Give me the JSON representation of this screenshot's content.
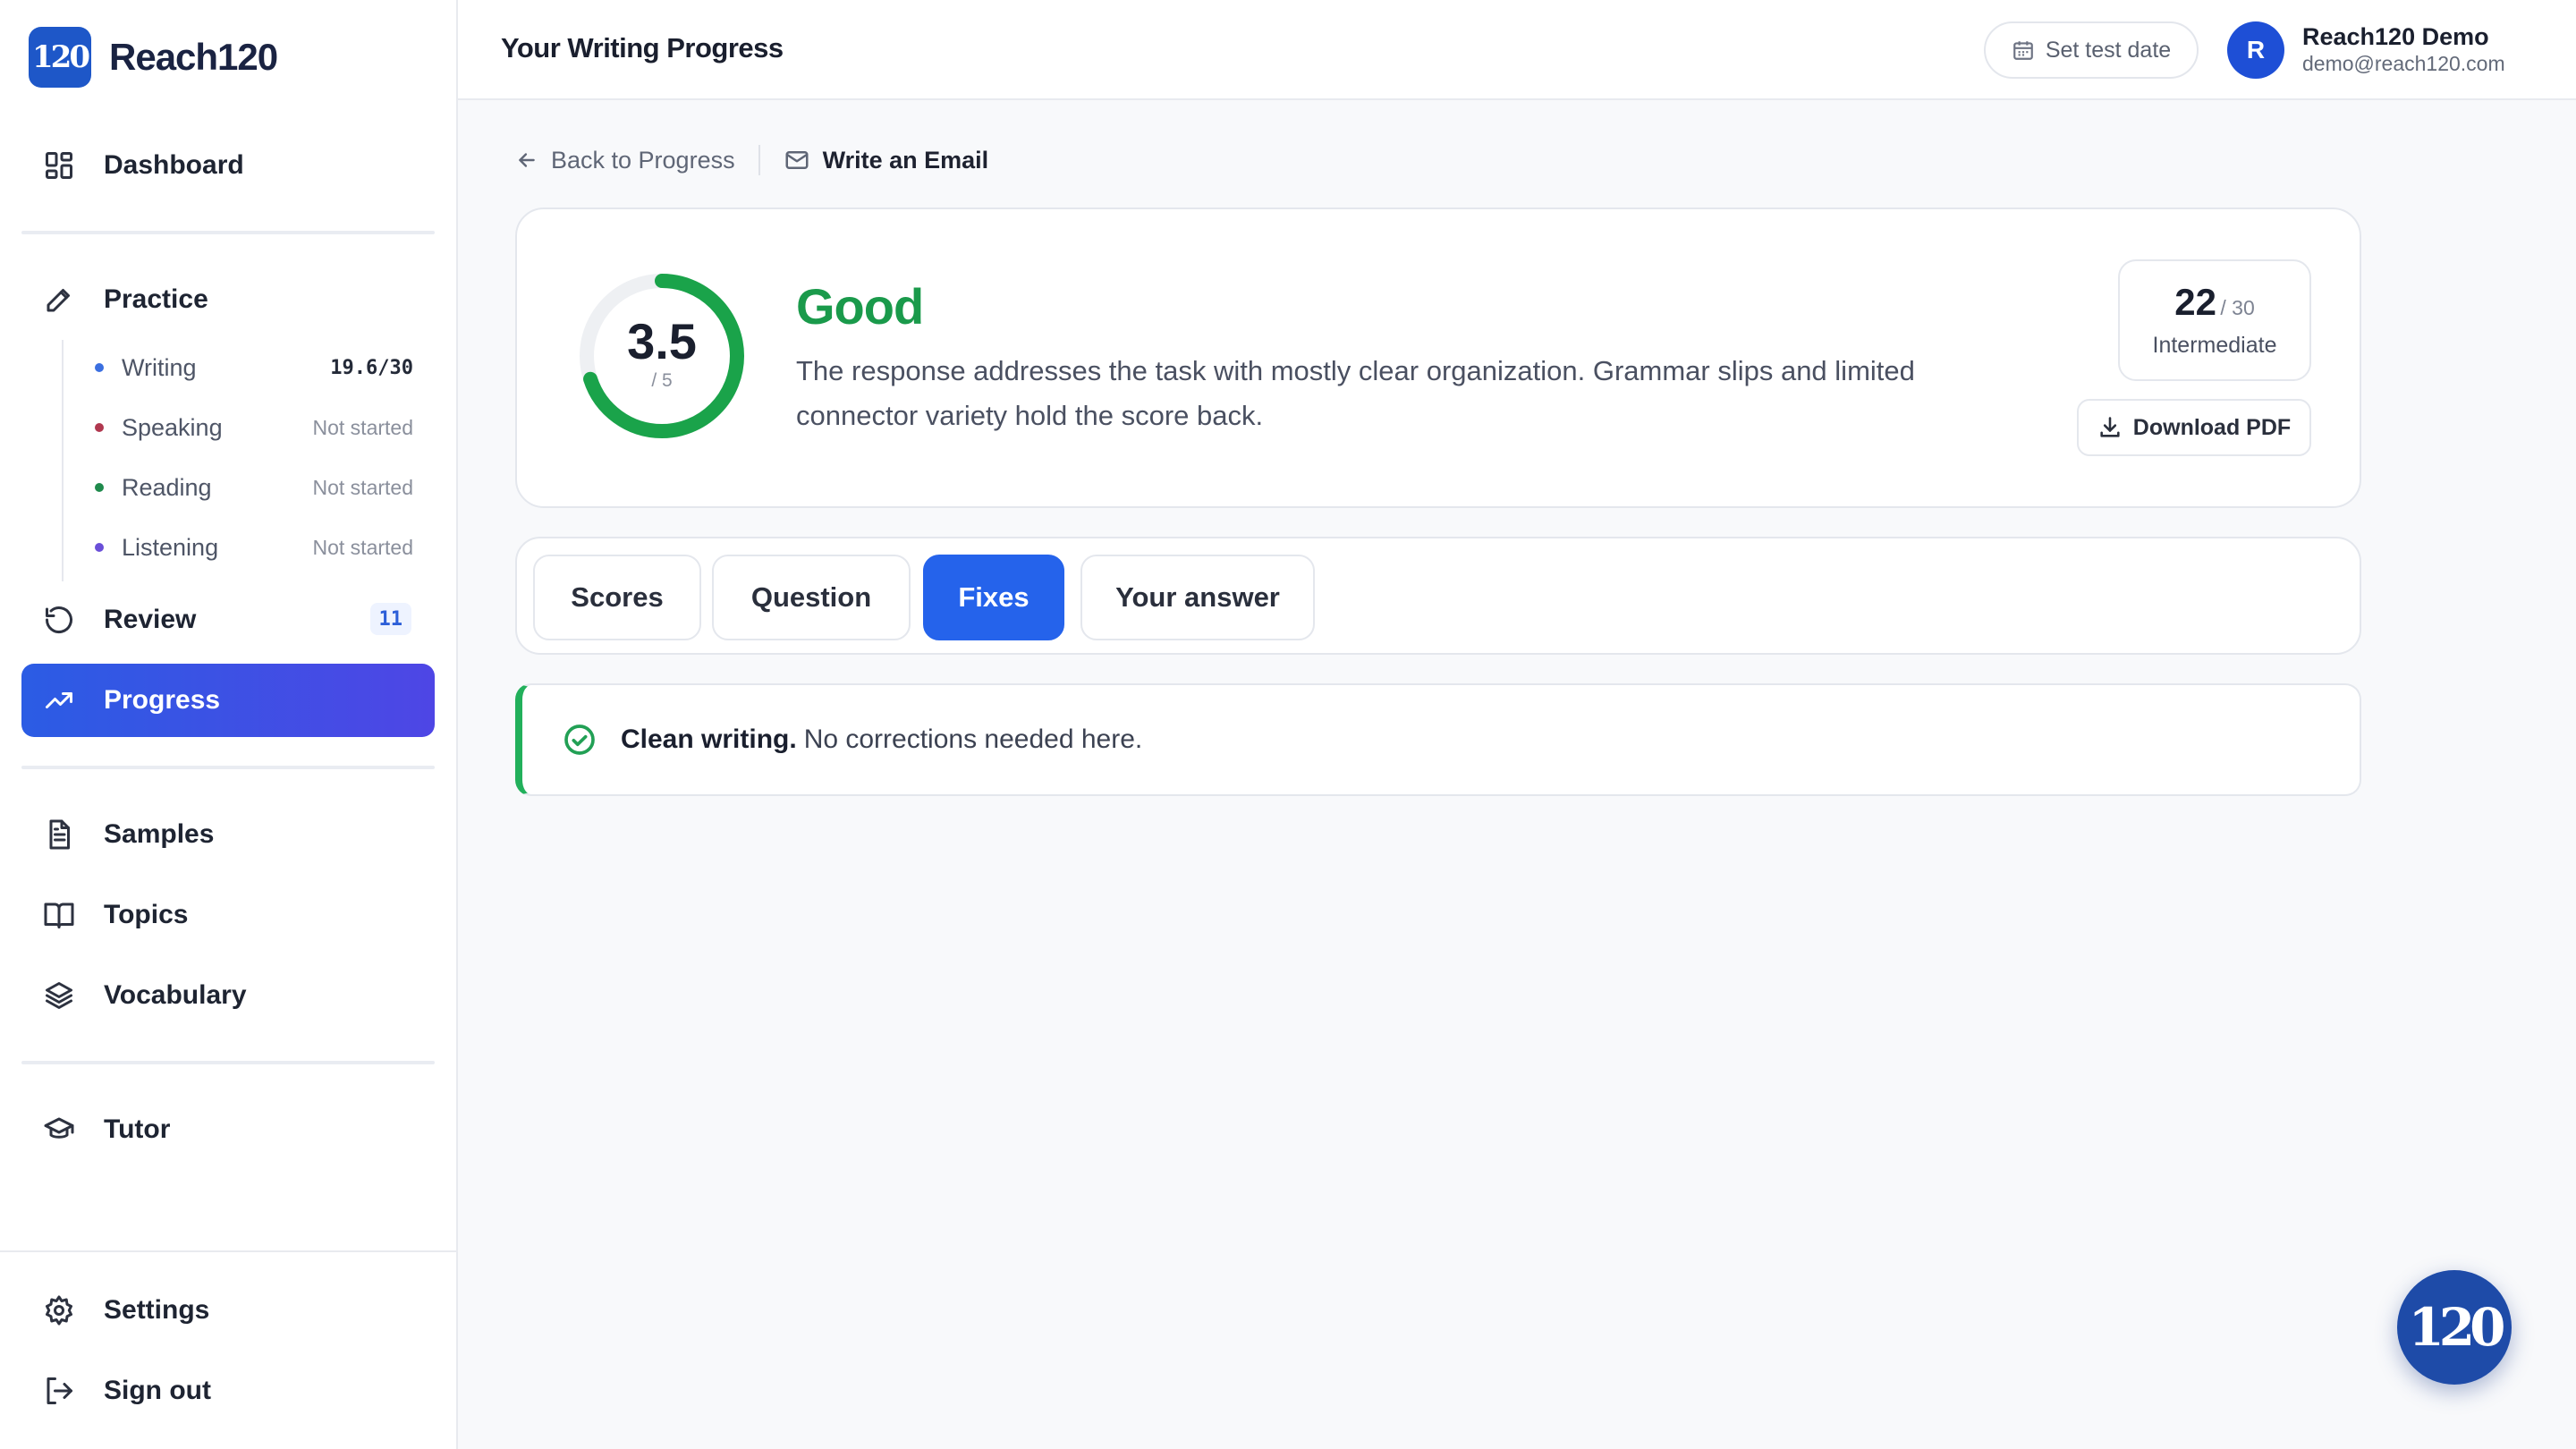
{
  "brand": {
    "logo_text": "120",
    "name": "Reach120"
  },
  "sidebar": {
    "dashboard": "Dashboard",
    "practice": "Practice",
    "practice_items": [
      {
        "label": "Writing",
        "status": "19.6/30",
        "dot_color": "#3b6fe0"
      },
      {
        "label": "Speaking",
        "status": "Not started",
        "dot_color": "#b0384f"
      },
      {
        "label": "Reading",
        "status": "Not started",
        "dot_color": "#1f8a4c"
      },
      {
        "label": "Listening",
        "status": "Not started",
        "dot_color": "#6a4fd8"
      }
    ],
    "review": "Review",
    "review_badge": "11",
    "progress": "Progress",
    "samples": "Samples",
    "topics": "Topics",
    "vocabulary": "Vocabulary",
    "tutor": "Tutor",
    "settings": "Settings",
    "sign_out": "Sign out"
  },
  "header": {
    "title": "Your Writing Progress",
    "set_test_date": "Set test date",
    "avatar_initial": "R",
    "user_name": "Reach120 Demo",
    "user_email": "demo@reach120.com"
  },
  "breadcrumb": {
    "back": "Back to Progress",
    "current": "Write an Email"
  },
  "result": {
    "score": "3.5",
    "score_max": "/ 5",
    "score_fraction": 0.7,
    "grade": "Good",
    "feedback": "The response addresses the task with mostly clear organization. Grammar slips and limited connector variety hold the score back.",
    "level_score": "22",
    "level_max": "/ 30",
    "level_name": "Intermediate",
    "download": "Download PDF"
  },
  "tabs": [
    {
      "label": "Scores",
      "active": false
    },
    {
      "label": "Question",
      "active": false
    },
    {
      "label": "Fixes",
      "active": true
    },
    {
      "label": "Your answer",
      "active": false
    }
  ],
  "fixes": {
    "title": "Clean writing.",
    "message": "No corrections needed here."
  },
  "colors": {
    "accent": "#2563eb",
    "success": "#1a9a4b",
    "brand": "#1e57c8"
  }
}
